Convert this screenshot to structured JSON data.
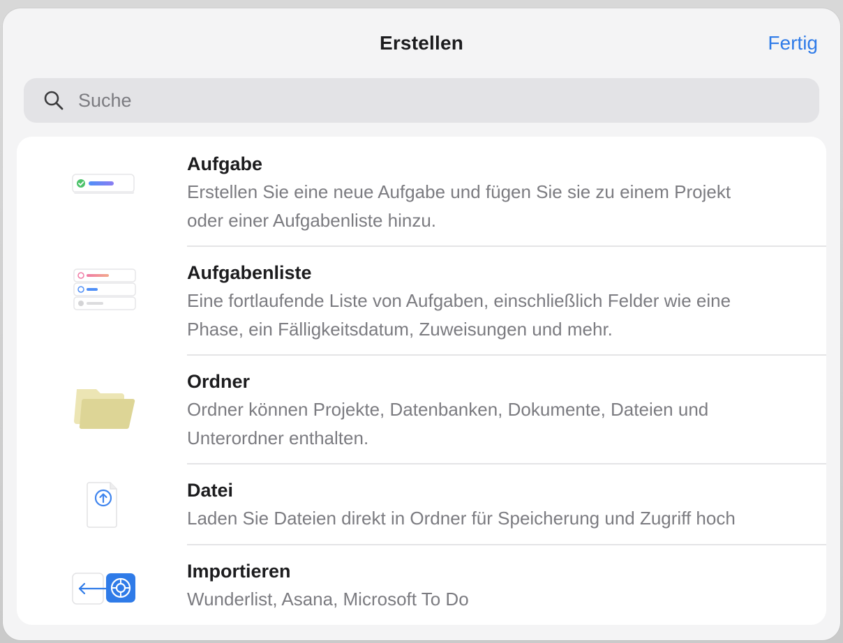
{
  "header": {
    "title": "Erstellen",
    "done_label": "Fertig"
  },
  "search": {
    "placeholder": "Suche",
    "value": "",
    "icon": "search-icon"
  },
  "items": [
    {
      "title": "Aufgabe",
      "description_line1": "Erstellen Sie eine neue Aufgabe und fügen Sie sie zu einem Projekt",
      "description_line2": "oder einer Aufgabenliste hinzu.",
      "icon": "task-icon"
    },
    {
      "title": "Aufgabenliste",
      "description_line1": "Eine fortlaufende Liste von Aufgaben, einschließlich Felder wie eine",
      "description_line2": "Phase, ein Fälligkeitsdatum, Zuweisungen und mehr.",
      "icon": "task-list-icon"
    },
    {
      "title": "Ordner",
      "description_line1": "Ordner können Projekte, Datenbanken, Dokumente, Dateien und",
      "description_line2": "Unterordner enthalten.",
      "icon": "folder-icon"
    },
    {
      "title": "Datei",
      "description_line1": "Laden Sie Dateien direkt in Ordner für Speicherung und Zugriff hoch",
      "icon": "file-upload-icon"
    },
    {
      "title": "Importieren",
      "description_line1": "Wunderlist, Asana, Microsoft To Do",
      "icon": "import-icon"
    }
  ],
  "colors": {
    "accent": "#2f7be8",
    "folder": "#ddd596",
    "check_green": "#4cc26a"
  }
}
